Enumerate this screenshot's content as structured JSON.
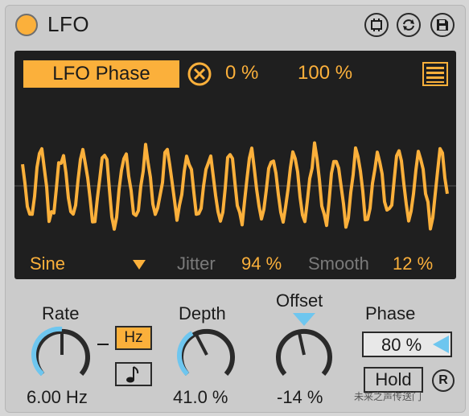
{
  "device": {
    "title": "LFO",
    "accent": "#fbb03b",
    "blue": "#6ec6ef",
    "display_bg": "#1f1f1f"
  },
  "titlebar_icons": [
    "map-icon",
    "hot-swap-icon",
    "save-icon"
  ],
  "display": {
    "target_button": "LFO Phase",
    "min": "0 %",
    "max": "100 %",
    "shape": "Sine",
    "jitter_label": "Jitter",
    "jitter_value": "94 %",
    "smooth_label": "Smooth",
    "smooth_value": "12 %"
  },
  "controls": {
    "rate": {
      "label": "Rate",
      "value": "6.00 Hz",
      "hz_label": "Hz"
    },
    "depth": {
      "label": "Depth",
      "value": "41.0 %"
    },
    "offset": {
      "label": "Offset",
      "value": "-14 %"
    },
    "phase": {
      "label": "Phase",
      "value": "80 %"
    },
    "hold_label": "Hold",
    "retrigger_label": "R"
  },
  "watermark": "未来之声传送门"
}
